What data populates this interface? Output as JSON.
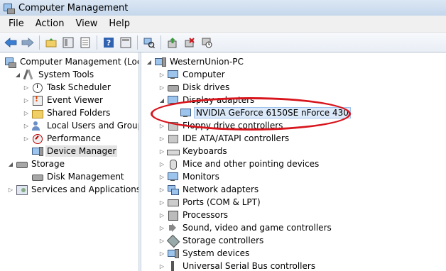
{
  "window": {
    "title": "Computer Management"
  },
  "menu": {
    "items": [
      "File",
      "Action",
      "View",
      "Help"
    ]
  },
  "toolbar": {
    "buttons": [
      "back-icon",
      "forward-icon",
      "up-folder-icon",
      "console-tree-icon",
      "properties-icon",
      "help-icon",
      "console-icon",
      "scan-hardware-icon",
      "update-driver-icon",
      "uninstall-icon",
      "disable-icon"
    ]
  },
  "left_tree": {
    "items": [
      {
        "label": "Computer Management (Local"
      },
      {
        "label": "System Tools"
      },
      {
        "label": "Task Scheduler"
      },
      {
        "label": "Event Viewer"
      },
      {
        "label": "Shared Folders"
      },
      {
        "label": "Local Users and Groups"
      },
      {
        "label": "Performance"
      },
      {
        "label": "Device Manager"
      },
      {
        "label": "Storage"
      },
      {
        "label": "Disk Management"
      },
      {
        "label": "Services and Applications"
      }
    ]
  },
  "device_tree": {
    "root": "WesternUnion-PC",
    "items": [
      {
        "label": "Computer"
      },
      {
        "label": "Disk drives"
      },
      {
        "label": "Display adapters"
      },
      {
        "label": "NVIDIA GeForce 6150SE nForce 430"
      },
      {
        "label": "Floppy drive controllers"
      },
      {
        "label": "IDE ATA/ATAPI controllers"
      },
      {
        "label": "Keyboards"
      },
      {
        "label": "Mice and other pointing devices"
      },
      {
        "label": "Monitors"
      },
      {
        "label": "Network adapters"
      },
      {
        "label": "Ports (COM & LPT)"
      },
      {
        "label": "Processors"
      },
      {
        "label": "Sound, video and game controllers"
      },
      {
        "label": "Storage controllers"
      },
      {
        "label": "System devices"
      },
      {
        "label": "Universal Serial Bus controllers"
      }
    ]
  },
  "annotation": {
    "color": "#d8141c"
  }
}
